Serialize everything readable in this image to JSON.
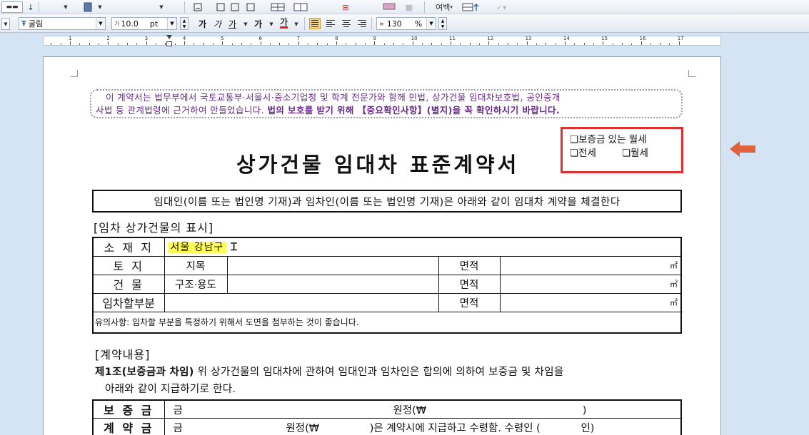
{
  "toolbar1": {
    "margin_label": "여백"
  },
  "toolbar2": {
    "font_name": "굴림",
    "font_size": "10.0",
    "font_unit": "pt",
    "bold": "가",
    "italic": "가",
    "underline": "가",
    "strike": "가",
    "font_color": "가",
    "line_spacing": "130",
    "line_spacing_unit": "%"
  },
  "ruler": {
    "labels": [
      "1",
      "2",
      "3",
      "4",
      "5",
      "6",
      "7",
      "8",
      "9",
      "10",
      "11",
      "12",
      "13",
      "14",
      "15",
      "16",
      "17"
    ]
  },
  "document": {
    "notice_line1": "이 계약서는 법무부에서 국토교통부·서울시·중소기업청 및 학계 전문가와 함께 민법, 상가건물 임대차보호법, 공인중개",
    "notice_line2_plain": "사법 등 관계법령에 근거하여 만들었습니다.",
    "notice_line2_bold": "법의 보호를 받기 위해 【중요확인사항】(별지)을 꼭 확인하시기 바랍니다.",
    "options": {
      "opt1": "❏보증금 있는 월세",
      "opt2": "❏전세",
      "opt3": "❏월세"
    },
    "title": "상가건물 임대차 표준계약서",
    "intro": "임대인(이름 또는 법인명 기재)과 임차인(이름 또는 법인명 기재)은 아래와 같이 임대차 계약을 체결한다",
    "section1": "[임차 상가건물의 표시]",
    "property": {
      "location_label": "소 재 지",
      "location_value": "서울 강남구",
      "land_label": "토   지",
      "land_sub": "지목",
      "building_label": "건   물",
      "building_sub": "구조·용도",
      "leased_label": "임차할부분",
      "area_label": "면적",
      "unit": "㎡",
      "note": "유의사항: 임차할 부분을 특정하기 위해서 도면을 첨부하는 것이 좋습니다."
    },
    "section2": "[계약내용]",
    "article1_title": "제1조(보증금과 차임)",
    "article1_line1": " 위 상가건물의 임대차에 관하여 임대인과 임차인은 합의에 의하여 보증금 및 차임을",
    "article1_line2": "아래와 같이 지급하기로 한다.",
    "payment": {
      "deposit_label": "보 증 금",
      "deposit_text": "금",
      "deposit_won": "원정(₩",
      "deposit_close": ")",
      "contract_label": "계 약 금",
      "contract_text": "금",
      "contract_won": "원정(₩",
      "contract_rest": ")은 계약시에 지급하고 수령함. 수령인 (",
      "contract_end": "인)"
    }
  },
  "colors": {
    "notice": "#6a2a8c",
    "highlight": "#ffff55",
    "option_border": "#e03030",
    "arrow": "#e0623a"
  }
}
